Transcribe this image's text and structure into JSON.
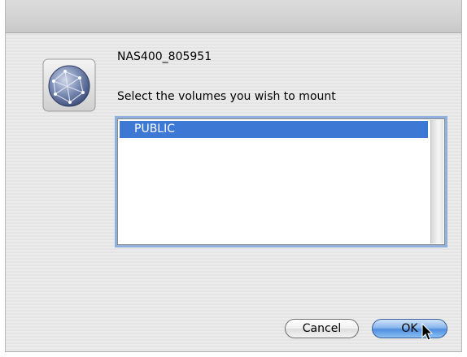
{
  "dialog": {
    "server_name": "NAS400_805951",
    "prompt": "Select the volumes you wish to mount",
    "icon": "network-server-icon"
  },
  "volumes": {
    "items": [
      {
        "label": "PUBLIC",
        "selected": true
      }
    ],
    "selection_color": "#3c78d4"
  },
  "buttons": {
    "cancel_label": "Cancel",
    "ok_label": "OK",
    "default_color": "#5b9ae6"
  },
  "cursor": "arrow-pointer-icon"
}
